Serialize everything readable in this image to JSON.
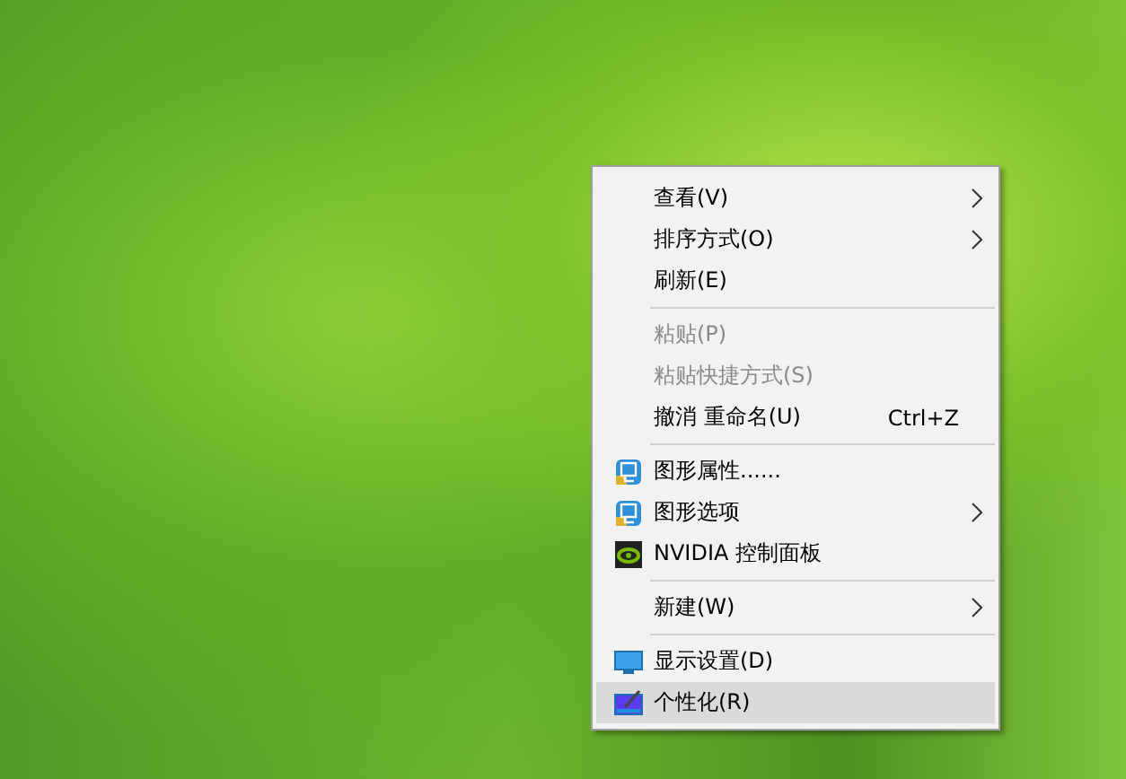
{
  "context_menu": {
    "items": [
      {
        "kind": "plain",
        "label": "查看(V)",
        "has_submenu": true,
        "disabled": false,
        "selected": false
      },
      {
        "kind": "plain",
        "label": "排序方式(O)",
        "has_submenu": true,
        "disabled": false,
        "selected": false
      },
      {
        "kind": "plain",
        "label": "刷新(E)",
        "has_submenu": false,
        "disabled": false,
        "selected": false
      },
      {
        "kind": "separator"
      },
      {
        "kind": "plain",
        "label": "粘贴(P)",
        "has_submenu": false,
        "disabled": true,
        "selected": false
      },
      {
        "kind": "plain",
        "label": "粘贴快捷方式(S)",
        "has_submenu": false,
        "disabled": true,
        "selected": false
      },
      {
        "kind": "plain",
        "label": "撤消 重命名(U)",
        "shortcut": "Ctrl+Z",
        "has_submenu": false,
        "disabled": false,
        "selected": false
      },
      {
        "kind": "separator"
      },
      {
        "kind": "graphics",
        "label": "图形属性......",
        "has_submenu": false,
        "disabled": false,
        "selected": false
      },
      {
        "kind": "graphics",
        "label": "图形选项",
        "has_submenu": true,
        "disabled": false,
        "selected": false
      },
      {
        "kind": "nvidia",
        "label": "NVIDIA 控制面板",
        "has_submenu": false,
        "disabled": false,
        "selected": false
      },
      {
        "kind": "separator"
      },
      {
        "kind": "plain",
        "label": "新建(W)",
        "has_submenu": true,
        "disabled": false,
        "selected": false
      },
      {
        "kind": "separator"
      },
      {
        "kind": "display",
        "label": "显示设置(D)",
        "has_submenu": false,
        "disabled": false,
        "selected": false
      },
      {
        "kind": "personalize",
        "label": "个性化(R)",
        "has_submenu": false,
        "disabled": false,
        "selected": true
      }
    ]
  }
}
